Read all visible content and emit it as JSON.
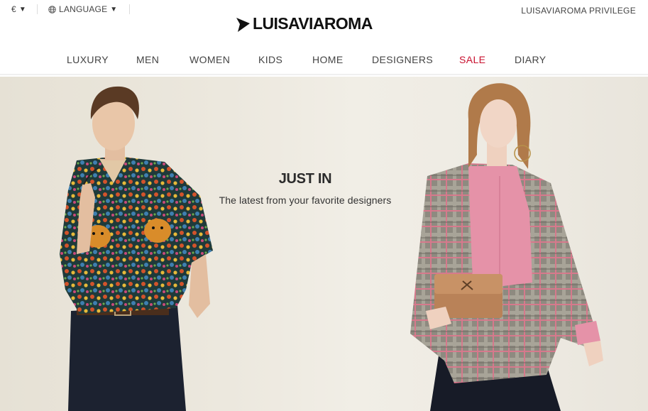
{
  "topbar": {
    "currency": "€",
    "language": "LANGUAGE",
    "privilege": "LUISAVIAROMA PRIVILEGE"
  },
  "brand": {
    "name": "LUISAVIAROMA"
  },
  "nav": {
    "items": [
      {
        "label": "LUXURY"
      },
      {
        "label": "MEN"
      },
      {
        "label": "WOMEN"
      },
      {
        "label": "KIDS"
      },
      {
        "label": "HOME"
      },
      {
        "label": "DESIGNERS"
      },
      {
        "label": "SALE"
      },
      {
        "label": "DIARY"
      }
    ]
  },
  "hero": {
    "title": "JUST IN",
    "subtitle": "The latest from your favorite designers"
  },
  "colors": {
    "sale": "#c8102e",
    "text": "#444444",
    "hero_background": "#ece8de"
  }
}
